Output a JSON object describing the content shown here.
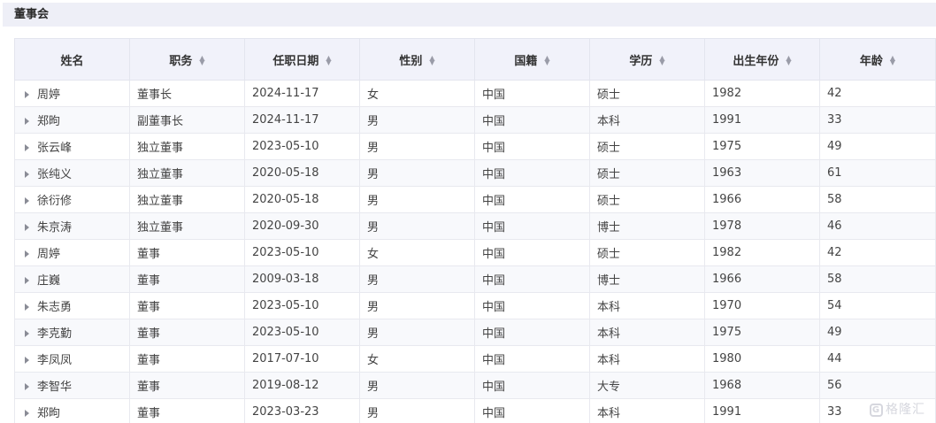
{
  "section": {
    "title": "董事会"
  },
  "table": {
    "headers": [
      {
        "label": "姓名",
        "sortable": false
      },
      {
        "label": "职务",
        "sortable": true
      },
      {
        "label": "任职日期",
        "sortable": true
      },
      {
        "label": "性别",
        "sortable": true
      },
      {
        "label": "国籍",
        "sortable": true
      },
      {
        "label": "学历",
        "sortable": true
      },
      {
        "label": "出生年份",
        "sortable": true
      },
      {
        "label": "年龄",
        "sortable": true
      }
    ],
    "sort_glyph_up": "▲",
    "sort_glyph_down": "▼",
    "rows": [
      [
        "周婷",
        "董事长",
        "2024-11-17",
        "女",
        "中国",
        "硕士",
        "1982",
        "42"
      ],
      [
        "郑昫",
        "副董事长",
        "2024-11-17",
        "男",
        "中国",
        "本科",
        "1991",
        "33"
      ],
      [
        "张云峰",
        "独立董事",
        "2023-05-10",
        "男",
        "中国",
        "硕士",
        "1975",
        "49"
      ],
      [
        "张纯义",
        "独立董事",
        "2020-05-18",
        "男",
        "中国",
        "硕士",
        "1963",
        "61"
      ],
      [
        "徐衍修",
        "独立董事",
        "2020-05-18",
        "男",
        "中国",
        "硕士",
        "1966",
        "58"
      ],
      [
        "朱京涛",
        "独立董事",
        "2020-09-30",
        "男",
        "中国",
        "博士",
        "1978",
        "46"
      ],
      [
        "周婷",
        "董事",
        "2023-05-10",
        "女",
        "中国",
        "硕士",
        "1982",
        "42"
      ],
      [
        "庄巍",
        "董事",
        "2009-03-18",
        "男",
        "中国",
        "博士",
        "1966",
        "58"
      ],
      [
        "朱志勇",
        "董事",
        "2023-05-10",
        "男",
        "中国",
        "本科",
        "1970",
        "54"
      ],
      [
        "李克勤",
        "董事",
        "2023-05-10",
        "男",
        "中国",
        "本科",
        "1975",
        "49"
      ],
      [
        "李凤凤",
        "董事",
        "2017-07-10",
        "女",
        "中国",
        "本科",
        "1980",
        "44"
      ],
      [
        "李智华",
        "董事",
        "2019-08-12",
        "男",
        "中国",
        "大专",
        "1968",
        "56"
      ],
      [
        "郑昫",
        "董事",
        "2023-03-23",
        "男",
        "中国",
        "本科",
        "1991",
        "33"
      ]
    ]
  },
  "watermark": {
    "logo_letter": "G",
    "text": "格隆汇"
  },
  "colors": {
    "header_bg": "#f1f2fa",
    "section_bg": "#eeeff7",
    "zebra_bg": "#f8f9fc",
    "border": "#e8e9ef",
    "text": "#444444"
  },
  "icons": {
    "row_expand": "caret-right-icon",
    "sort": "sort-icon"
  }
}
